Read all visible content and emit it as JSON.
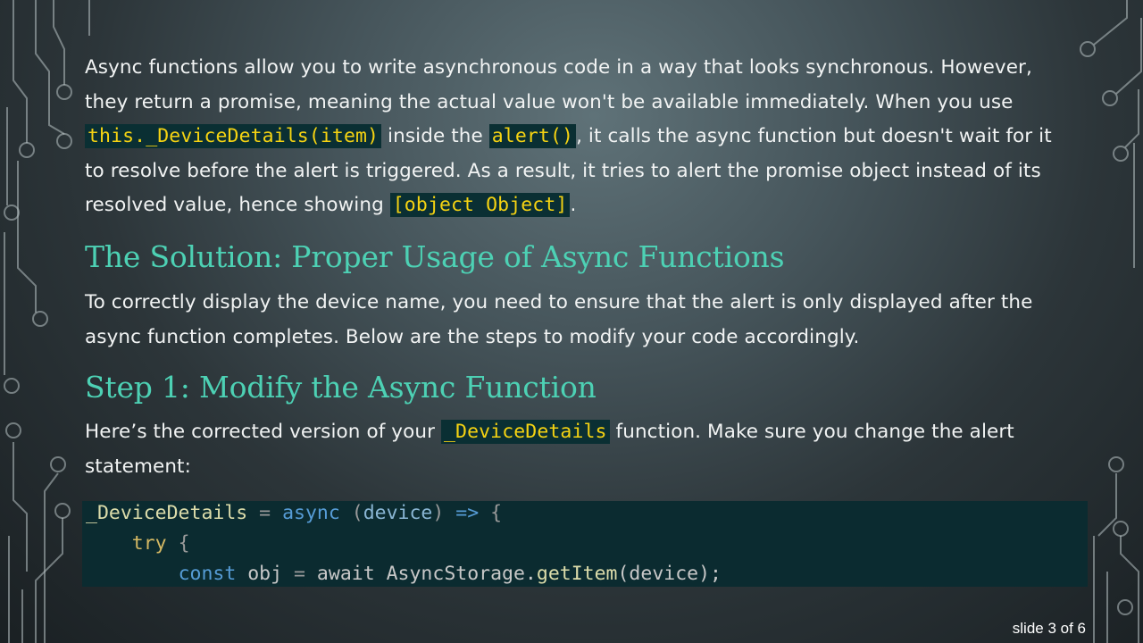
{
  "paragraph1": {
    "t1": "Async functions allow you to write asynchronous code in a way that looks synchronous. However, they return a promise, meaning the actual value won't be available immediately. When you use ",
    "code1": "this._DeviceDetails(item)",
    "t2": " inside the ",
    "code2": "alert()",
    "t3": ", it calls the async function but doesn't wait for it to resolve before the alert is triggered. As a result, it tries to alert the promise object instead of its resolved value, hence showing ",
    "code3": "[object Object]",
    "t4": "."
  },
  "heading1": "The Solution: Proper Usage of Async Functions",
  "paragraph2": "To correctly display the device name, you need to ensure that the alert is only displayed after the async function completes. Below are the steps to modify your code accordingly.",
  "heading2": "Step 1: Modify the Async Function",
  "paragraph3": {
    "t1": "Here’s the corrected version of your ",
    "code1": "_DeviceDetails",
    "t2": " function. Make sure you change the alert statement:"
  },
  "code_block": {
    "line1": [
      "_DeviceDetails",
      " = ",
      "async",
      " (",
      "device",
      ") ",
      "=>",
      " {"
    ],
    "line2": [
      "    ",
      "try",
      " {"
    ],
    "line3": [
      "        ",
      "const",
      " obj ",
      "=",
      " await AsyncStorage.",
      "getItem",
      "(device);"
    ]
  },
  "slide_indicator": "slide 3 of 6",
  "colors": {
    "heading": "#4dd1b4",
    "inline_code_text": "#f5d312",
    "inline_code_bg": "#0a2f33",
    "code_block_bg": "#0b2b30"
  }
}
